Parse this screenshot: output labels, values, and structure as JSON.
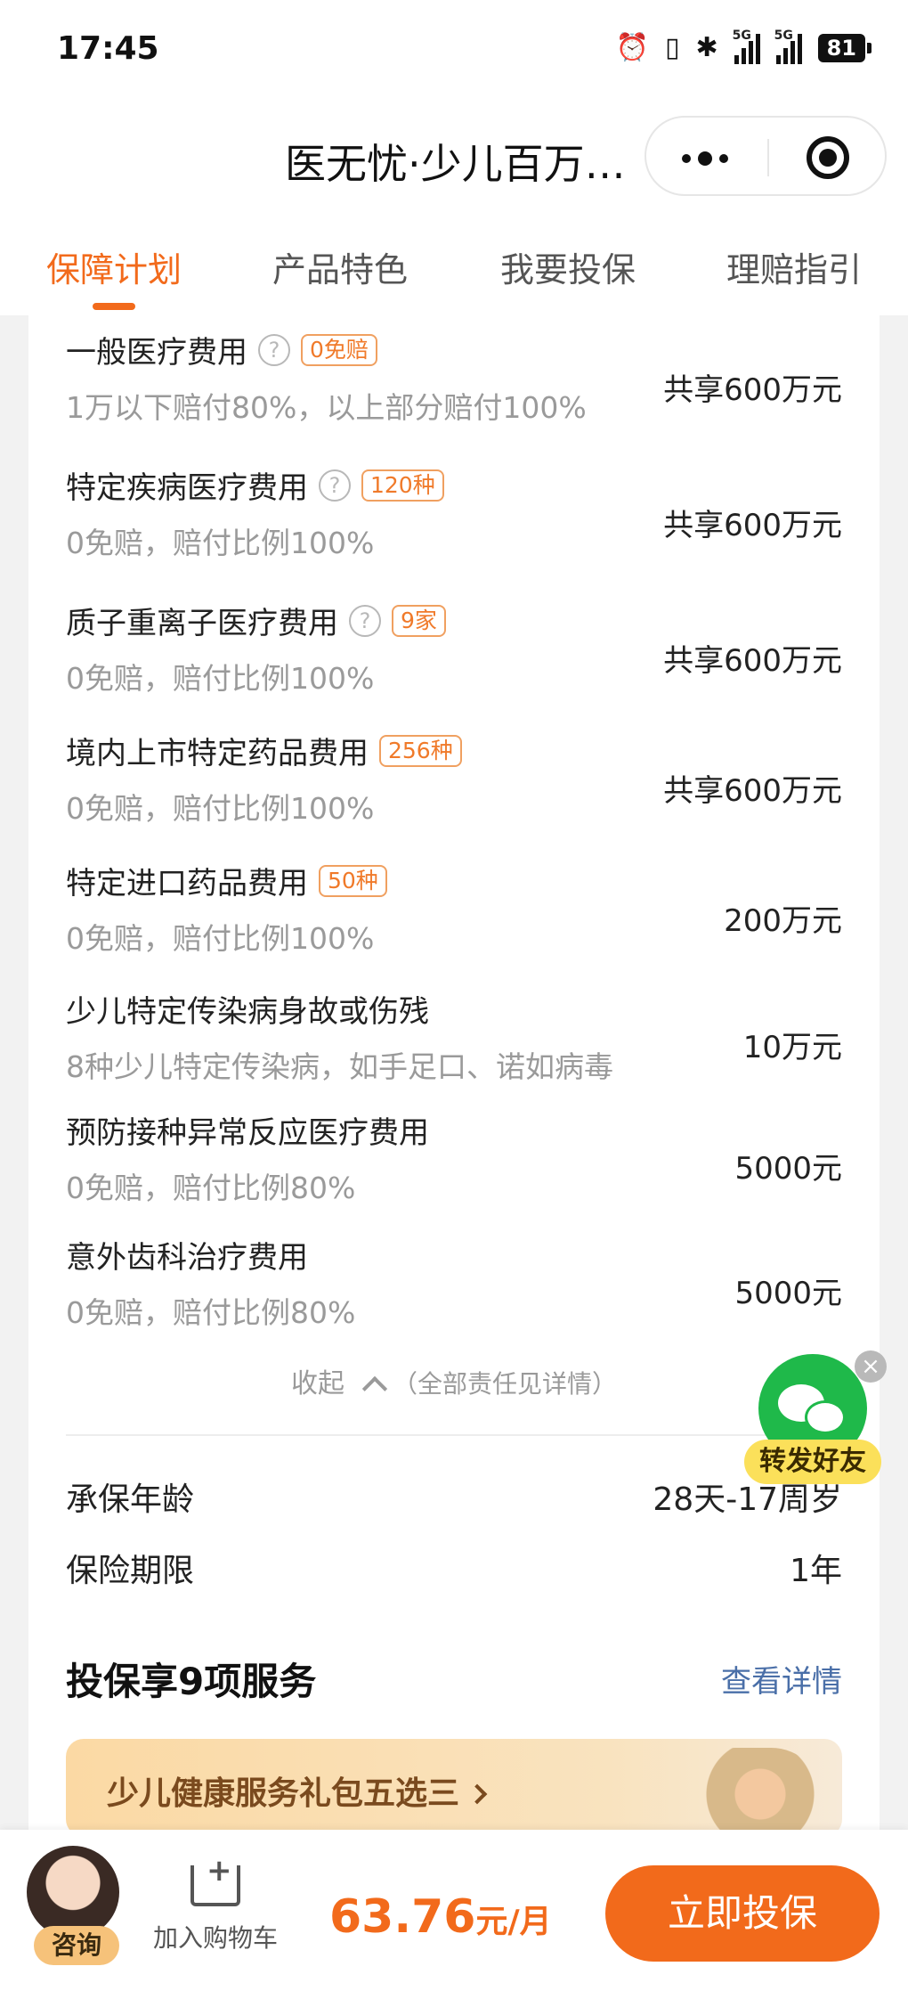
{
  "status_bar": {
    "time": "17:45",
    "battery": "81",
    "signal_label": "5G"
  },
  "nav": {
    "title": "医无忧·少儿百万…"
  },
  "tabs": [
    {
      "label": "保障计划",
      "active": true
    },
    {
      "label": "产品特色",
      "active": false
    },
    {
      "label": "我要投保",
      "active": false
    },
    {
      "label": "理赔指引",
      "active": false
    }
  ],
  "coverage": [
    {
      "title": "一般医疗费用",
      "help": true,
      "tag": "0免赔",
      "sub": "1万以下赔付80%，以上部分赔付100%",
      "amount": "共享600万元"
    },
    {
      "title": "特定疾病医疗费用",
      "help": true,
      "tag": "120种",
      "sub": "0免赔，赔付比例100%",
      "amount": "共享600万元"
    },
    {
      "title": "质子重离子医疗费用",
      "help": true,
      "tag": "9家",
      "sub": "0免赔，赔付比例100%",
      "amount": "共享600万元"
    },
    {
      "title": "境内上市特定药品费用",
      "help": false,
      "tag": "256种",
      "sub": "0免赔，赔付比例100%",
      "amount": "共享600万元"
    },
    {
      "title": "特定进口药品费用",
      "help": false,
      "tag": "50种",
      "sub": "0免赔，赔付比例100%",
      "amount": "200万元"
    },
    {
      "title": "少儿特定传染病身故或伤残",
      "help": false,
      "tag": "",
      "sub": "8种少儿特定传染病，如手足口、诺如病毒",
      "amount": "10万元"
    },
    {
      "title": "预防接种异常反应医疗费用",
      "help": false,
      "tag": "",
      "sub": "0免赔，赔付比例80%",
      "amount": "5000元"
    },
    {
      "title": "意外齿科治疗费用",
      "help": false,
      "tag": "",
      "sub": "0免赔，赔付比例80%",
      "amount": "5000元"
    }
  ],
  "collapse": {
    "label": "收起",
    "note": "（全部责任见详情）"
  },
  "info": [
    {
      "label": "承保年龄",
      "value": "28天-17周岁"
    },
    {
      "label": "保险期限",
      "value": "1年"
    }
  ],
  "services": {
    "title": "投保享9项服务",
    "link": "查看详情",
    "gift": "少儿健康服务礼包五选三"
  },
  "share": {
    "label": "转发好友"
  },
  "bottom": {
    "consult": "咨询",
    "cart": "加入购物车",
    "price": "63.76",
    "price_unit": "元/月",
    "buy": "立即投保"
  },
  "colors": {
    "accent": "#f26a1b",
    "link": "#4a6fa8",
    "wechat": "#1fb94a"
  }
}
